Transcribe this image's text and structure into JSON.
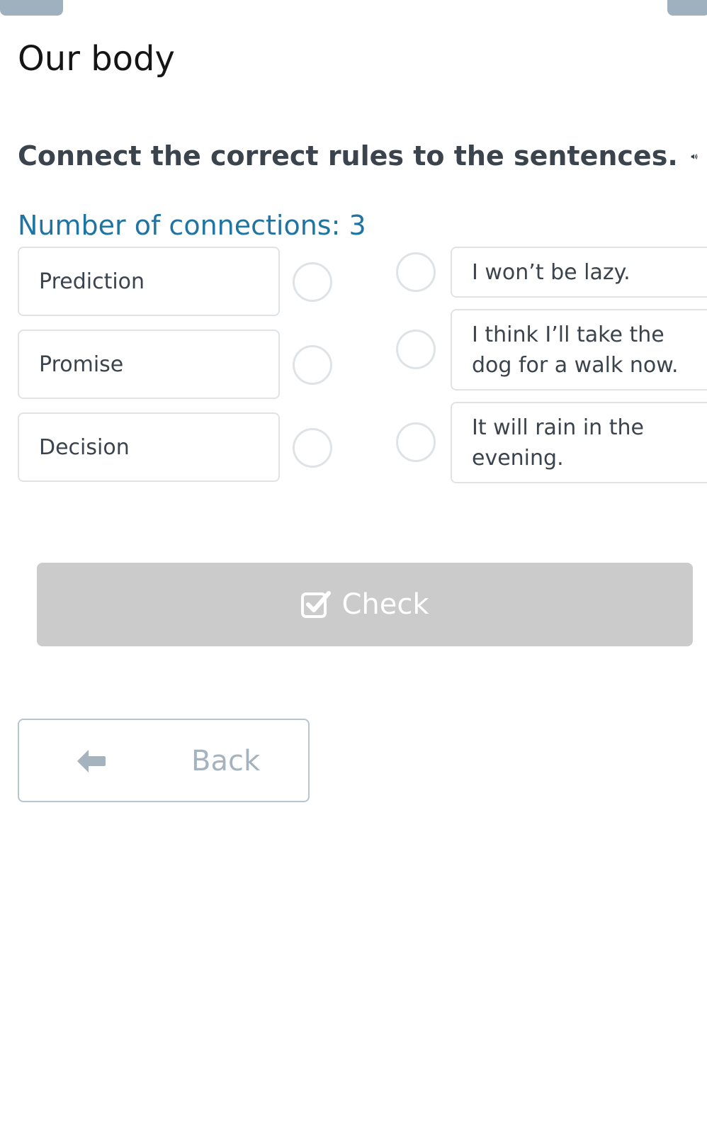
{
  "page": {
    "title": "Our body"
  },
  "exercise": {
    "instruction": "Connect the correct rules to the sentences.",
    "connections_label": "Number of connections: 3",
    "left_items": [
      {
        "label": "Prediction"
      },
      {
        "label": "Promise"
      },
      {
        "label": "Decision"
      }
    ],
    "right_items": [
      {
        "label": "I won’t be lazy."
      },
      {
        "label": "I think I’ll take the dog for a walk now."
      },
      {
        "label": "It will rain in the evening."
      }
    ]
  },
  "buttons": {
    "check_label": "Check",
    "back_label": "Back"
  },
  "icons": {
    "speaker": "speaker-icon",
    "check": "check-square-icon",
    "back": "arrow-left-icon"
  },
  "colors": {
    "heading_accent": "#1f74a2",
    "check_button_bg": "#cbcbcb",
    "back_text": "#a4b3bd",
    "border": "#dfe3e6"
  }
}
